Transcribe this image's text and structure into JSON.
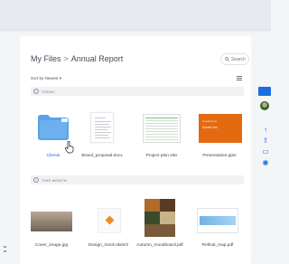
{
  "breadcrumb": {
    "root": "My Files",
    "separator": ">",
    "current": "Annual Report"
  },
  "search": {
    "placeholder": "Search"
  },
  "sort": {
    "label": "Sort by Newest",
    "arrow": "▾"
  },
  "sections": [
    {
      "label": "TODAY",
      "check": "✓"
    },
    {
      "label": "THIS MONTH",
      "check": "✓"
    }
  ],
  "today_files": [
    {
      "name": "Clients",
      "type": "folder",
      "selected": true
    },
    {
      "name": "Brand_proposal.docx",
      "type": "document"
    },
    {
      "name": "Project plan.xlsx",
      "type": "spreadsheet"
    },
    {
      "name": "Presentation.pptx",
      "type": "presentation"
    }
  ],
  "month_files": [
    {
      "name": "Cover_image.jpg",
      "type": "image"
    },
    {
      "name": "Design_mock.sketch",
      "type": "sketch"
    },
    {
      "name": "Autumn_moodboard.pdf",
      "type": "pdf"
    },
    {
      "name": "Refinal_map.pdf",
      "type": "pdf"
    }
  ],
  "presentation_thumb": {
    "title": "Acme Inc.",
    "subtitle": "Annual Report"
  },
  "colors": {
    "accent": "#1a6fe0",
    "folder": "#5aa2e8",
    "presentation": "#e46a12"
  },
  "icons": [
    "search-icon",
    "list-view-icon",
    "folder-icon",
    "share-icon",
    "upload-icon",
    "eye-icon",
    "pointer-cursor-icon"
  ]
}
